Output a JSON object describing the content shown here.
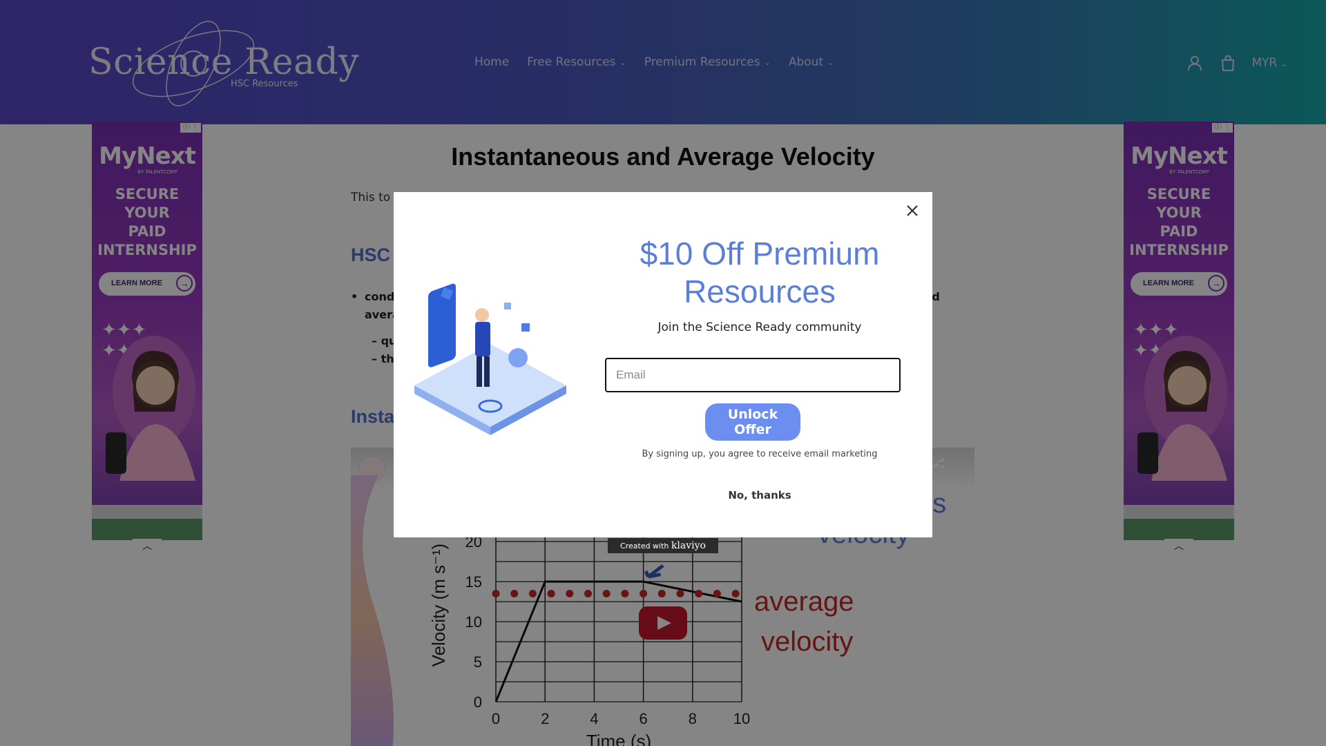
{
  "header": {
    "logo_text": "Science Ready",
    "logo_sub": "HSC Resources",
    "nav": [
      {
        "label": "Home",
        "has_dropdown": false
      },
      {
        "label": "Free Resources",
        "has_dropdown": true
      },
      {
        "label": "Premium Resources",
        "has_dropdown": true
      },
      {
        "label": "About",
        "has_dropdown": true
      }
    ],
    "currency": "MYR",
    "icons": [
      "account-icon",
      "cart-icon",
      "chevron-down-icon"
    ]
  },
  "page": {
    "title": "Instantaneous and Average Velocity",
    "intro_visible": "This to",
    "h2_partial": "HSC",
    "bullet_line1_start": "cond",
    "bullet_line1_end": "nd",
    "bullet_line2_start": "avera",
    "sub1_start": "– qu",
    "sub2_start": "– th",
    "h2b_partial": "Insta"
  },
  "video": {
    "graph": {
      "ylabel": "Velocity (m s⁻¹)",
      "xlabel": "Time (s)",
      "y_ticks": [
        "0",
        "5",
        "10",
        "15",
        "20"
      ],
      "x_ticks": [
        "0",
        "2",
        "4",
        "6",
        "8",
        "10"
      ],
      "label_instantaneous_partial": "us",
      "label_instantaneous_line2": "velocity",
      "label_average_1": "average",
      "label_average_2": "velocity"
    },
    "share_label": "Share"
  },
  "ad": {
    "brand": "MyNext",
    "by": "BY TALENTCORP",
    "headline": [
      "SECURE",
      "YOUR",
      "PAID",
      "INTERNSHIP"
    ],
    "cta": "LEARN MORE"
  },
  "modal": {
    "title": "$10 Off Premium Resources",
    "subtitle": "Join the Science Ready community",
    "email_placeholder": "Email",
    "email_value": "",
    "button": "Unlock Offer",
    "legal": "By signing up, you agree to receive email marketing",
    "decline": "No, thanks",
    "badge_prefix": "Created with",
    "badge_brand": "klaviyo"
  },
  "colors": {
    "accent": "#6b8ef0",
    "title_blue": "#5b7fd8",
    "heading_blue": "#4f6fcf",
    "average_red": "#c62828"
  }
}
